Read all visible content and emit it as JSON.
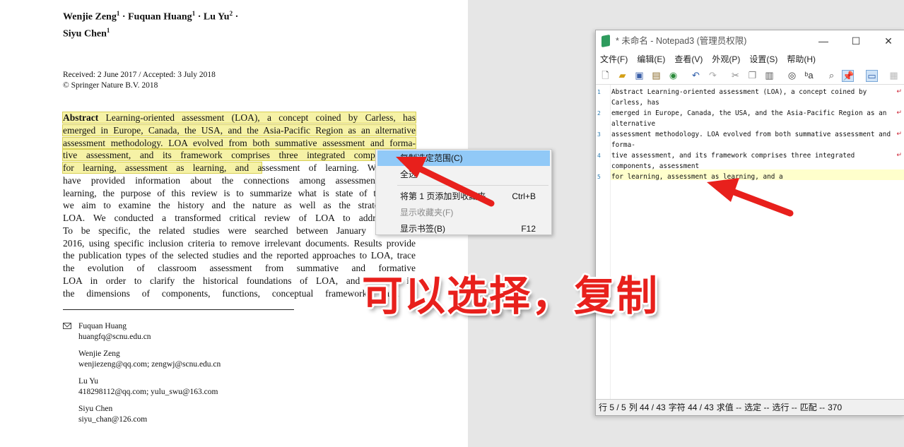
{
  "pdf": {
    "author_lines": [
      [
        {
          "name": "Wenjie Zeng",
          "sup": "1",
          "sep": " · "
        },
        {
          "name": "Fuquan Huang",
          "sup": "1",
          "sep": " · "
        },
        {
          "name": "Lu Yu",
          "sup": "2",
          "sep": " ·"
        }
      ],
      [
        {
          "name": "Siyu Chen",
          "sup": "1",
          "sep": ""
        }
      ]
    ],
    "received": "Received: 2 June 2017 / Accepted: 3 July 2018",
    "copyright": "© Springer Nature B.V. 2018",
    "abstract_label": "Abstract",
    "abstract_lines": [
      {
        "hl": "Learning-oriented assessment (LOA), a concept coined by Carless, has",
        "rest": ""
      },
      {
        "hl": "emerged in Europe, Canada, the USA, and the Asia-Pacific Region as an alternative",
        "rest": ""
      },
      {
        "hl": "assessment methodology. LOA evolved from both summative assessment and forma-",
        "rest": ""
      },
      {
        "hl": "tive assessment, and its framework comprises three integrated components, a",
        "rest": ""
      },
      {
        "hl": "for learning, assessment as learning, and a",
        "rest": "ssessment of learning. While a f"
      },
      {
        "hl": "",
        "rest": "have provided information about the connections among assessment for, a"
      },
      {
        "hl": "",
        "rest": "learning, the purpose of this review is to summarize what is state of the art of"
      },
      {
        "hl": "",
        "rest": "we aim to examine the history and the nature as well as the strategy of c"
      },
      {
        "hl": "",
        "rest": "LOA. We conducted a transformed critical review of LOA to address these"
      },
      {
        "hl": "",
        "rest": "To be specific, the related studies were searched between January 1971 and"
      },
      {
        "hl": "",
        "rest": "2016, using specific inclusion criteria to remove irrelevant documents. Results provide"
      },
      {
        "hl": "",
        "rest": "the publication types of the selected studies and the reported approaches to LOA, trace"
      },
      {
        "hl": "",
        "rest": "the evolution of classroom assessment from summative and formative"
      },
      {
        "hl": "",
        "rest": "LOA in order to clarify the historical foundations of LOA, and indicate its"
      },
      {
        "hl": "",
        "rest": "the dimensions of components, functions, conceptual frameworks, and p"
      }
    ],
    "contacts": [
      {
        "name": "Fuquan Huang",
        "email": "huangfq@scnu.edu.cn"
      },
      {
        "name": "Wenjie Zeng",
        "email": "wenjiezeng@qq.com; zengwj@scnu.edu.cn"
      },
      {
        "name": "Lu Yu",
        "email": "418298112@qq.com; yulu_swu@163.com"
      },
      {
        "name": "Siyu Chen",
        "email": "siyu_chan@126.com"
      }
    ]
  },
  "context_menu": {
    "items": [
      {
        "label": "复制选定范围(C)",
        "shortcut": "",
        "state": "selected"
      },
      {
        "label": "全选",
        "shortcut": "",
        "state": "normal"
      },
      {
        "separator": true
      },
      {
        "label": "将第 1 页添加到收藏夹",
        "shortcut": "Ctrl+B",
        "state": "normal"
      },
      {
        "label": "显示收藏夹(F)",
        "shortcut": "",
        "state": "disabled"
      },
      {
        "label": "显示书签(B)",
        "shortcut": "F12",
        "state": "normal"
      }
    ]
  },
  "notepad": {
    "title": "* 未命名 - Notepad3  (管理员权限)",
    "menu": [
      "文件(F)",
      "编辑(E)",
      "查看(V)",
      "外观(P)",
      "设置(S)",
      "帮助(H)"
    ],
    "lines": [
      {
        "num": "1",
        "rows": [
          "Abstract Learning-oriented assessment (LOA), a concept coined by",
          "Carless, has"
        ],
        "wrap": true
      },
      {
        "num": "2",
        "rows": [
          "emerged in Europe, Canada, the USA, and the Asia-Pacific Region as an",
          "alternative"
        ],
        "wrap": true
      },
      {
        "num": "3",
        "rows": [
          "assessment methodology. LOA evolved from both summative assessment and",
          "forma-"
        ],
        "wrap": true
      },
      {
        "num": "4",
        "rows": [
          "tive assessment, and its framework comprises three integrated",
          "components, assessment"
        ],
        "wrap": true
      },
      {
        "num": "5",
        "rows": [
          "for learning, assessment as learning, and a"
        ],
        "wrap": false
      }
    ],
    "status": [
      "行  5 / 5",
      "列  44 / 43",
      "字符  44 / 43",
      "求值  --",
      "选定  --",
      "选行  --",
      "匹配  --",
      "370"
    ]
  },
  "annotation": {
    "caption": "可以选择，复制",
    "color": "#e8201c"
  }
}
